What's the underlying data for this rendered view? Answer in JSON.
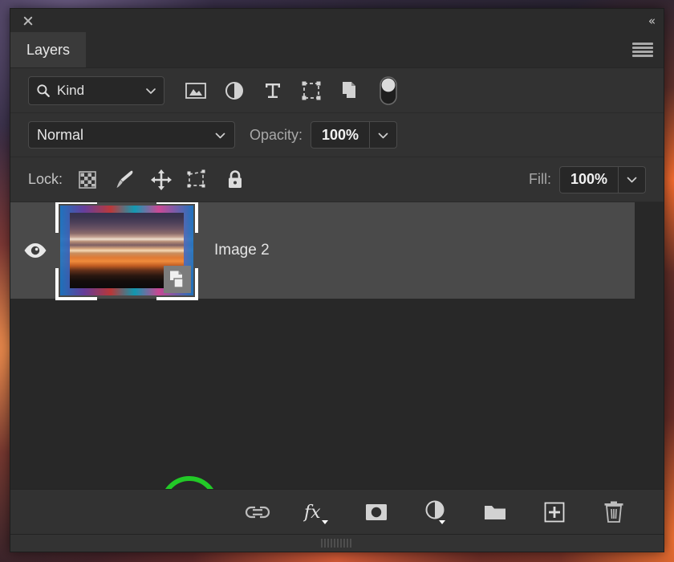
{
  "window": {
    "close_label": "✕",
    "collapse_label": "«"
  },
  "tabs": [
    {
      "label": "Layers",
      "active": true
    }
  ],
  "panel_menu": {
    "icon": "hamburger-menu-icon"
  },
  "filter_row": {
    "kind_label": "Kind",
    "search_icon": "search-icon",
    "chevron": "chevron-down-icon",
    "filter_icons": [
      {
        "name": "pixel-layer-filter-icon",
        "title": "Filter for pixel layers"
      },
      {
        "name": "adjustment-layer-filter-icon",
        "title": "Filter for adjustment layers"
      },
      {
        "name": "type-layer-filter-icon",
        "title": "Filter for type layers"
      },
      {
        "name": "shape-layer-filter-icon",
        "title": "Filter for shape layers"
      },
      {
        "name": "smart-object-filter-icon",
        "title": "Filter for smart objects"
      },
      {
        "name": "filter-toggle-switch",
        "title": "Turn layer filtering on/off"
      }
    ]
  },
  "blend_row": {
    "blend_mode": "Normal",
    "opacity_label": "Opacity:",
    "opacity_value": "100%",
    "chevron": "chevron-down-icon"
  },
  "lock_row": {
    "lock_label": "Lock:",
    "lock_icons": [
      {
        "name": "lock-transparent-pixels-icon"
      },
      {
        "name": "lock-image-pixels-icon"
      },
      {
        "name": "lock-position-icon"
      },
      {
        "name": "lock-artboard-nesting-icon"
      },
      {
        "name": "lock-all-icon"
      }
    ],
    "fill_label": "Fill:",
    "fill_value": "100%"
  },
  "layers": [
    {
      "name": "Image 2",
      "visible": true,
      "selected": true,
      "badge": "smart-object-badge-icon"
    }
  ],
  "annotation": {
    "type": "highlight-circle",
    "color": "#22c927",
    "target": "smart-object-badge-icon"
  },
  "bottom_toolbar": [
    {
      "name": "link-layers-icon",
      "label": "Link layers"
    },
    {
      "name": "layer-style-fx-icon",
      "label": "fx"
    },
    {
      "name": "add-layer-mask-icon",
      "label": "Add layer mask"
    },
    {
      "name": "new-fill-adjustment-layer-icon",
      "label": "New fill or adjustment layer"
    },
    {
      "name": "new-group-icon",
      "label": "Create a new group"
    },
    {
      "name": "new-layer-icon",
      "label": "Create a new layer"
    },
    {
      "name": "delete-layer-icon",
      "label": "Delete layer"
    }
  ],
  "colors": {
    "panel_bg": "#323232",
    "titlebar_bg": "#2b2b2b",
    "list_bg": "#282828",
    "row_selected_bg": "#4a4a4a",
    "text": "#e4e4e4",
    "accent_highlight": "#22c927"
  }
}
